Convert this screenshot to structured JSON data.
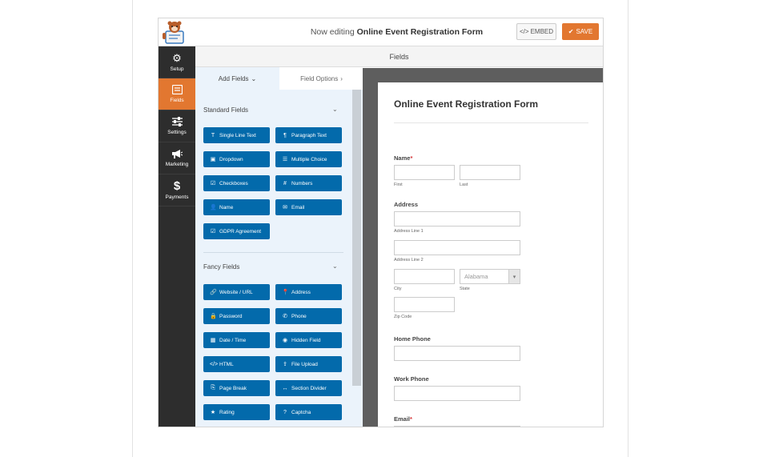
{
  "header": {
    "editing_prefix": "Now editing",
    "form_name": "Online Event Registration Form",
    "embed_label": "EMBED",
    "save_label": "SAVE"
  },
  "sidebar": {
    "items": [
      {
        "label": "Setup",
        "icon": "gear-icon"
      },
      {
        "label": "Fields",
        "icon": "fields-icon"
      },
      {
        "label": "Settings",
        "icon": "sliders-icon"
      },
      {
        "label": "Marketing",
        "icon": "megaphone-icon"
      },
      {
        "label": "Payments",
        "icon": "dollar-icon"
      }
    ]
  },
  "fields_title": "Fields",
  "panel": {
    "tabs": [
      {
        "label": "Add Fields",
        "suffix": "⌄"
      },
      {
        "label": "Field Options",
        "suffix": "›"
      }
    ],
    "standard_title": "Standard Fields",
    "fancy_title": "Fancy Fields",
    "standard": [
      {
        "label": "Single Line Text",
        "glyph": "T"
      },
      {
        "label": "Paragraph Text",
        "glyph": "¶"
      },
      {
        "label": "Dropdown",
        "glyph": "▣"
      },
      {
        "label": "Multiple Choice",
        "glyph": "☰"
      },
      {
        "label": "Checkboxes",
        "glyph": "☑"
      },
      {
        "label": "Numbers",
        "glyph": "#"
      },
      {
        "label": "Name",
        "glyph": "👤"
      },
      {
        "label": "Email",
        "glyph": "✉"
      },
      {
        "label": "GDPR Agreement",
        "glyph": "☑"
      }
    ],
    "fancy": [
      {
        "label": "Website / URL",
        "glyph": "🔗"
      },
      {
        "label": "Address",
        "glyph": "📍"
      },
      {
        "label": "Password",
        "glyph": "🔒"
      },
      {
        "label": "Phone",
        "glyph": "✆"
      },
      {
        "label": "Date / Time",
        "glyph": "▦"
      },
      {
        "label": "Hidden Field",
        "glyph": "◉"
      },
      {
        "label": "HTML",
        "glyph": "</>"
      },
      {
        "label": "File Upload",
        "glyph": "⇪"
      },
      {
        "label": "Page Break",
        "glyph": "⎘"
      },
      {
        "label": "Section Divider",
        "glyph": "↔"
      },
      {
        "label": "Rating",
        "glyph": "★"
      },
      {
        "label": "Captcha",
        "glyph": "?"
      }
    ]
  },
  "preview": {
    "title": "Online Event Registration Form",
    "name_label": "Name",
    "first": "First",
    "last": "Last",
    "address_label": "Address",
    "address_line1": "Address Line 1",
    "address_line2": "Address Line 2",
    "city": "City",
    "state": "State",
    "state_value": "Alabama",
    "zip": "Zip Code",
    "home_phone": "Home Phone",
    "work_phone": "Work Phone",
    "email_label": "Email",
    "required_mark": "*"
  },
  "colors": {
    "accent": "#e27730",
    "field_button": "#036aab",
    "sidebar": "#2d2d2d",
    "panel": "#ebf3fb"
  }
}
